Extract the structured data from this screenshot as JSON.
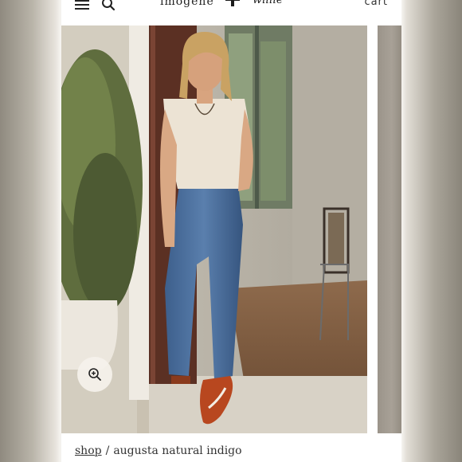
{
  "header": {
    "logo_left": "imogene",
    "logo_right": "willie",
    "cart_label": "cart",
    "icons": [
      "menu-icon",
      "search-icon",
      "plus-icon"
    ]
  },
  "product": {
    "image_alt": "augusta natural indigo"
  },
  "zoom": {
    "icon": "zoom-in-icon"
  },
  "breadcrumb": {
    "shop_label": "shop",
    "separator": "/",
    "current": "augusta natural indigo"
  }
}
